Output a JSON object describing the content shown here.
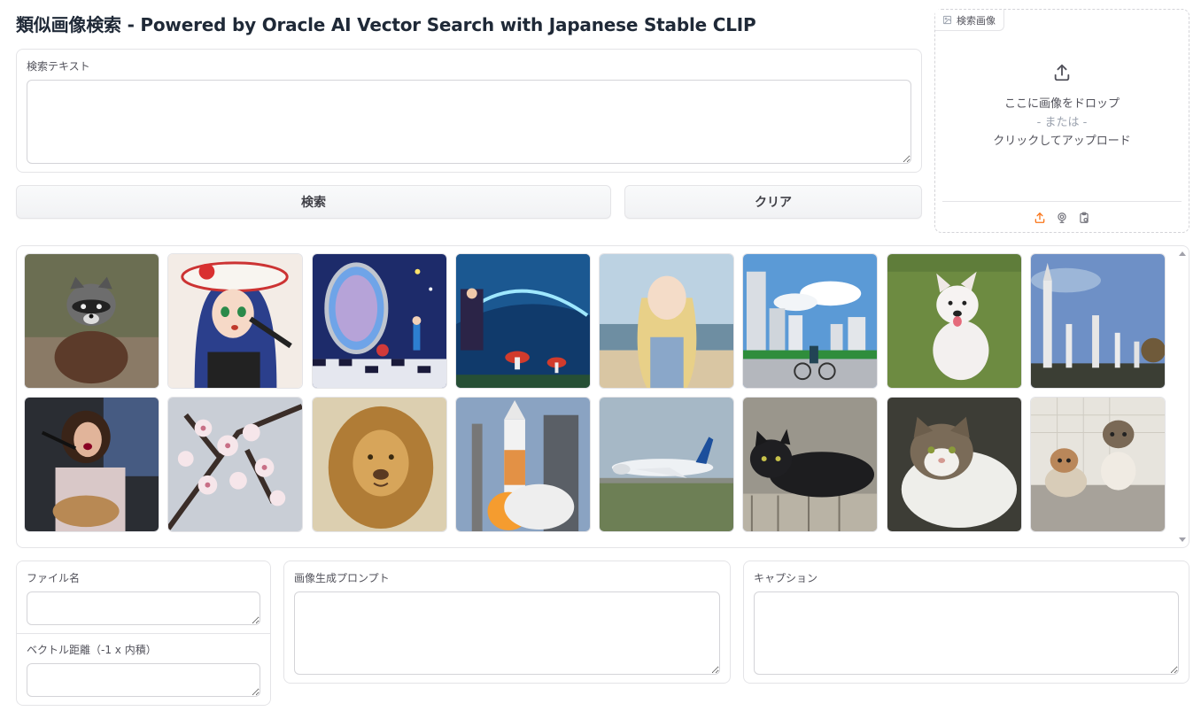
{
  "title": "類似画像検索 - Powered by Oracle AI Vector Search with Japanese Stable CLIP",
  "search_text": {
    "label": "検索テキスト",
    "value": ""
  },
  "buttons": {
    "search": "検索",
    "clear": "クリア"
  },
  "image_upload": {
    "label": "検索画像",
    "drop_text": "ここに画像をドロップ",
    "or_text": "- または -",
    "click_text": "クリックしてアップロード",
    "source_icons": [
      "upload-icon",
      "webcam-icon",
      "clipboard-icon"
    ]
  },
  "gallery": {
    "items": [
      {
        "name": "raccoon-image",
        "icon": "raccoon"
      },
      {
        "name": "anime-singer-image",
        "icon": "anime-girl"
      },
      {
        "name": "fantasy-mirror-image",
        "icon": "mirror"
      },
      {
        "name": "fantasy-library-image",
        "icon": "fantasy"
      },
      {
        "name": "beach-girl-image",
        "icon": "beach-girl"
      },
      {
        "name": "city-cyclist-image",
        "icon": "city"
      },
      {
        "name": "white-puppy-image",
        "icon": "puppy"
      },
      {
        "name": "rocket-garden-image",
        "icon": "rockets"
      },
      {
        "name": "guitar-singer-image",
        "icon": "singer"
      },
      {
        "name": "cherry-blossom-image",
        "icon": "blossom"
      },
      {
        "name": "lion-image",
        "icon": "lion"
      },
      {
        "name": "rocket-launch-image",
        "icon": "launch"
      },
      {
        "name": "airbus-plane-image",
        "icon": "plane"
      },
      {
        "name": "black-cat-image",
        "icon": "black-cat"
      },
      {
        "name": "white-tabby-cat-image",
        "icon": "tabby-cat"
      },
      {
        "name": "kittens-image",
        "icon": "kittens"
      }
    ]
  },
  "file_name": {
    "label": "ファイル名",
    "value": ""
  },
  "vector_distance": {
    "label": "ベクトル距離（-1 x 内積）",
    "value": ""
  },
  "prompt": {
    "label": "画像生成プロンプト",
    "value": ""
  },
  "caption": {
    "label": "キャプション",
    "value": ""
  },
  "colors": {
    "accent": "#f97316",
    "border": "#e4e4e7",
    "button_bg": "#f3f4f6"
  }
}
